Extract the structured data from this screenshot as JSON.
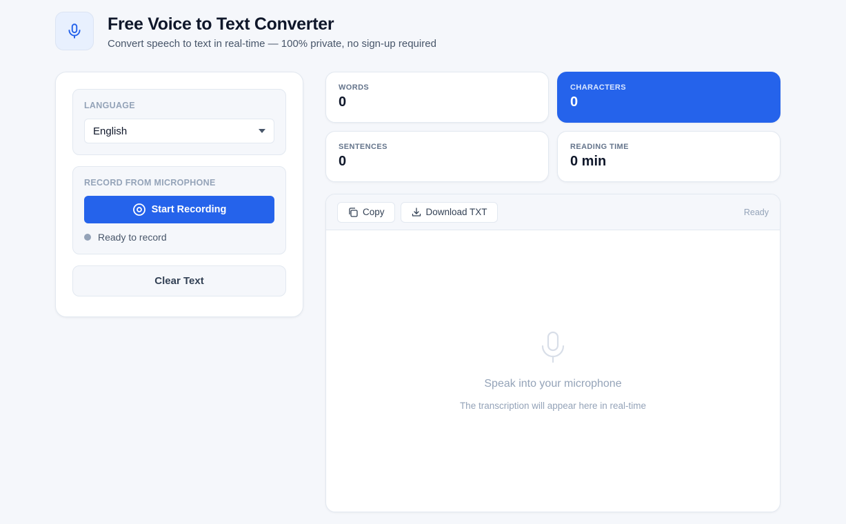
{
  "header": {
    "title": "Free Voice to Text Converter",
    "subtitle": "Convert speech to text in real-time — 100% private, no sign-up required",
    "logo_icon": "microphone-icon"
  },
  "controls": {
    "language_label": "LANGUAGE",
    "language_value": "English",
    "record_label": "RECORD FROM MICROPHONE",
    "record_button": "Start Recording",
    "record_status": "Ready to record",
    "clear_button": "Clear Text"
  },
  "stats": {
    "words_label": "WORDS",
    "words_value": "0",
    "characters_label": "CHARACTERS",
    "characters_value": "0",
    "sentences_label": "SENTENCES",
    "sentences_value": "0",
    "reading_label": "READING TIME",
    "reading_value": "0 min"
  },
  "editor": {
    "copy_button": "Copy",
    "download_button": "Download TXT",
    "status": "Ready",
    "empty_title": "Speak into your microphone",
    "empty_subtitle": "The transcription will appear here in real-time"
  },
  "colors": {
    "accent": "#2563eb",
    "background": "#f5f7fb",
    "muted": "#94a3b8"
  }
}
